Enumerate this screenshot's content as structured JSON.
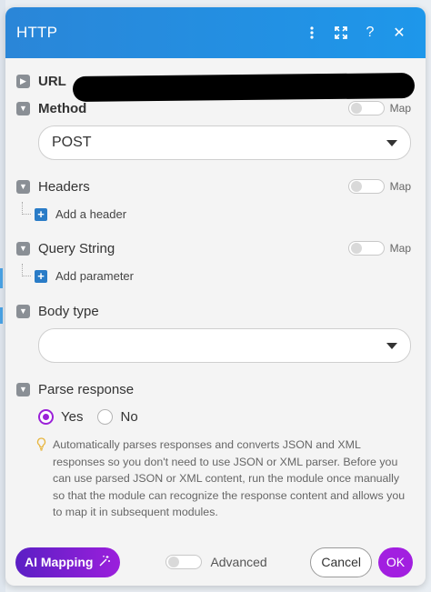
{
  "header": {
    "title": "HTTP",
    "icons": [
      "more-vertical-icon",
      "expand-icon",
      "help-icon",
      "close-icon"
    ]
  },
  "fields": {
    "url_label": "URL",
    "method_label": "Method",
    "method_value": "POST",
    "headers_label": "Headers",
    "add_header": "Add a header",
    "query_label": "Query String",
    "add_parameter": "Add parameter",
    "body_type_label": "Body type",
    "body_type_value": "",
    "parse_label": "Parse response",
    "map_label": "Map"
  },
  "parse": {
    "yes": "Yes",
    "no": "No",
    "selected": "Yes",
    "hint": "Automatically parses responses and converts JSON and XML responses so you don't need to use JSON or XML parser. Before you can use parsed JSON or XML content, run the module once manually so that the module can recognize the response content and allows you to map it in subsequent modules."
  },
  "footer": {
    "ai_mapping": "AI Mapping",
    "advanced": "Advanced",
    "cancel": "Cancel",
    "ok": "OK"
  },
  "colors": {
    "header": "#1e97ea",
    "accent": "#a21fe0",
    "add_icon": "#2a7cc7"
  }
}
